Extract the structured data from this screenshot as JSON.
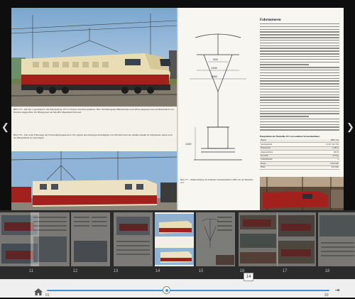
{
  "reader": {
    "prev_icon": "chevron-left-icon",
    "next_icon": "chevron-right-icon",
    "left_page": {
      "caption1": "Bild 175 – Die für 1 garantierten 103-Einzelstücke 103 113 haben zuweilen gefahren. Hier im Hintergrund Bahnbetriebswerk (Bw) eingesetzt und als Brückenlok von Nutzlok angetroffen. Im Hintergrund am Mu-Hbf Mannheim Personal.",
      "caption2": "Bild 176 – Die sechs Fahrzeuge der Fernverkehrsgeneration 103 zeigten eine Reisegeschwindigkeit von 200 km/h und die erhöhte Anzahl an Sitzplätzen; heute noch als Museumslok zu besichtigen.",
      "caption1_ref": "Bild 175",
      "caption2_ref": "Bild 176"
    },
    "right_page": {
      "heading": "Fahrmotoren",
      "drawing_labels": [
        "900",
        "1450",
        "1950",
        "1150"
      ],
      "table_title": "Hauptdaten der Baureihe 103 verwendeten Stromabnehmer",
      "table": [
        [
          "Bauart",
          "DBS 54a"
        ],
        [
          "Stromsystem",
          "15 kV 16,7 Hz"
        ],
        [
          "Nennstrom",
          "1.100 A"
        ],
        [
          "Anpressdruck",
          "120 N"
        ],
        [
          "Gewicht",
          "210 kg"
        ],
        [
          "Schleifstücke",
          "2"
        ],
        [
          "Breite",
          "1.950 mm"
        ],
        [
          "Höhe",
          "455 mm"
        ]
      ],
      "caption3": "Bild 177 – Maßzeichnung des Einholm-Stromabnehmers DBS 54a der Baureihe 103."
    }
  },
  "thumbnails": [
    {
      "page": "11",
      "state": "dim"
    },
    {
      "page": "12",
      "state": "dim"
    },
    {
      "page": "13",
      "state": "dim"
    },
    {
      "page": "14",
      "state": "current"
    },
    {
      "page": "15",
      "state": "dim"
    },
    {
      "page": "16",
      "state": "dim"
    },
    {
      "page": "17",
      "state": "dim"
    },
    {
      "page": "18",
      "state": "dim"
    }
  ],
  "slider": {
    "min_label": "01",
    "max_label": "20",
    "tooltip": "14",
    "end_icon": "skip-to-end-icon",
    "home_icon": "home-icon"
  },
  "colors": {
    "accent": "#3c90d6",
    "loco_red": "#a2211c",
    "loco_cream": "#e9ddb6",
    "strip_bg": "#2b2b2b"
  }
}
